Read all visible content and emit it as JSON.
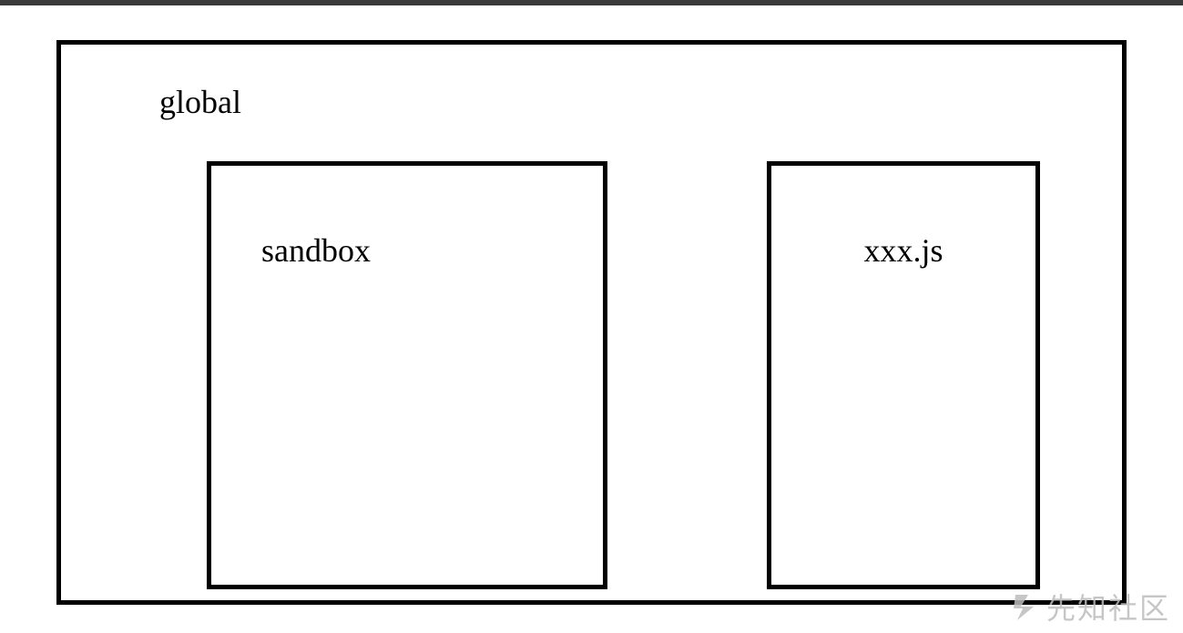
{
  "diagram": {
    "outer_label": "global",
    "inner_left_label": "sandbox",
    "inner_right_label": "xxx.js"
  },
  "watermark": {
    "text": "先知社区"
  }
}
